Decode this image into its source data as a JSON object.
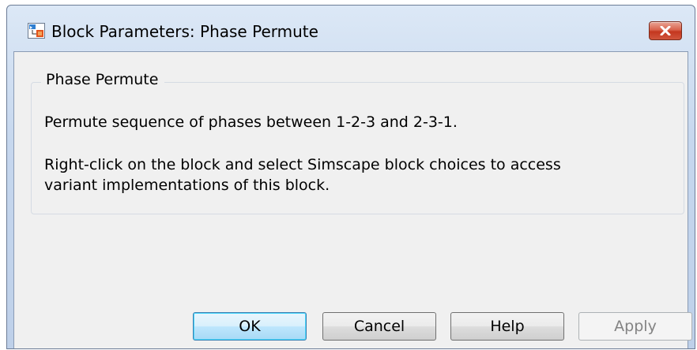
{
  "window": {
    "title": "Block Parameters: Phase Permute",
    "app_icon": "simulink-block-icon",
    "close_icon": "close-icon"
  },
  "group": {
    "title": "Phase Permute",
    "description_line1": "Permute sequence of phases between 1-2-3 and 2-3-1.",
    "description_line2": "Right-click on the block and select Simscape block choices to access",
    "description_line3": "variant implementations of this block."
  },
  "buttons": {
    "ok": "OK",
    "cancel": "Cancel",
    "help": "Help",
    "apply": "Apply"
  },
  "colors": {
    "title_bar": "#c6d7ee",
    "close_button": "#c4371f",
    "default_button_border": "#3c7fb1",
    "client_background": "#f0f0f0"
  }
}
